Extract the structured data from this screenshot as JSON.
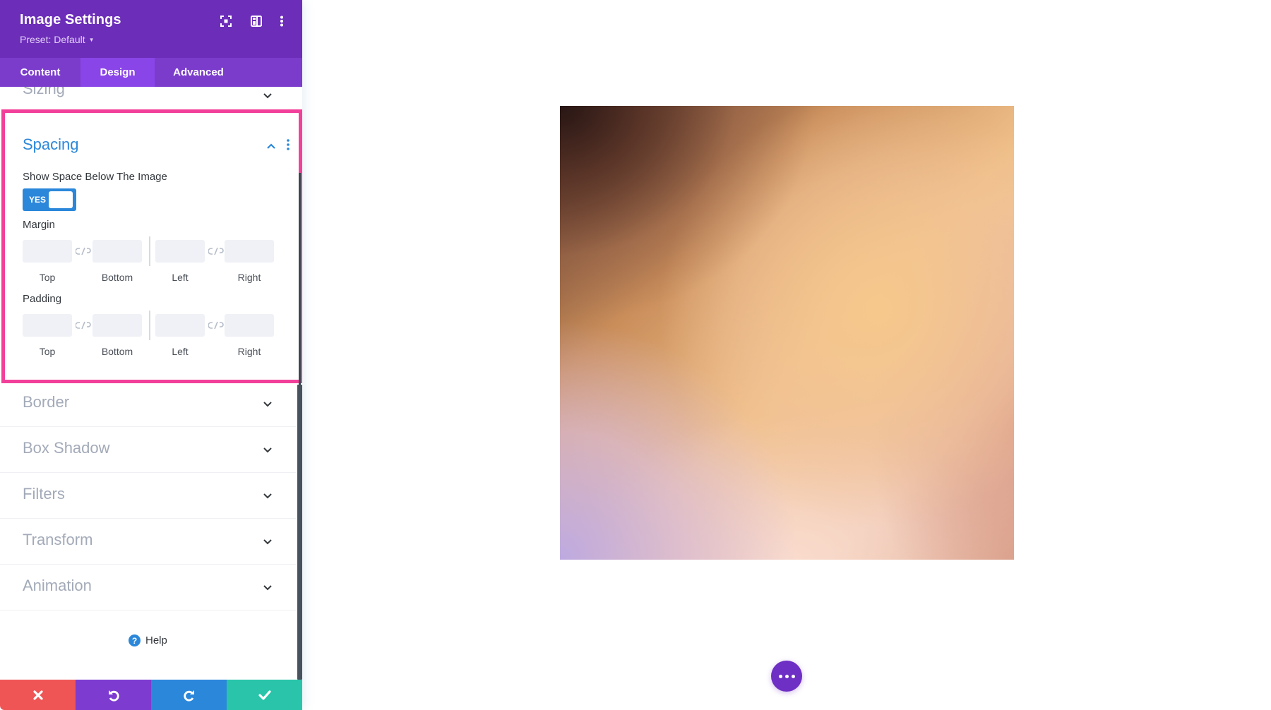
{
  "panel": {
    "title": "Image Settings",
    "preset_label": "Preset: Default",
    "header_icons": [
      "fullscreen-icon",
      "split-view-icon",
      "more-vertical-icon"
    ],
    "tabs": [
      {
        "label": "Content",
        "active": false
      },
      {
        "label": "Design",
        "active": true
      },
      {
        "label": "Advanced",
        "active": false
      }
    ]
  },
  "sections": {
    "sizing": {
      "label": "Sizing",
      "expanded": false
    },
    "spacing": {
      "label": "Spacing",
      "expanded": true,
      "show_space_label": "Show Space Below The Image",
      "toggle": {
        "label": "YES",
        "on": true
      },
      "margin": {
        "label": "Margin",
        "fields": [
          {
            "label": "Top",
            "value": ""
          },
          {
            "label": "Bottom",
            "value": ""
          },
          {
            "label": "Left",
            "value": ""
          },
          {
            "label": "Right",
            "value": ""
          }
        ]
      },
      "padding": {
        "label": "Padding",
        "fields": [
          {
            "label": "Top",
            "value": ""
          },
          {
            "label": "Bottom",
            "value": ""
          },
          {
            "label": "Left",
            "value": ""
          },
          {
            "label": "Right",
            "value": ""
          }
        ]
      }
    },
    "collapsed": [
      {
        "label": "Border"
      },
      {
        "label": "Box Shadow"
      },
      {
        "label": "Filters"
      },
      {
        "label": "Transform"
      },
      {
        "label": "Animation"
      }
    ]
  },
  "help_label": "Help",
  "footer": {
    "buttons": [
      "cancel",
      "undo",
      "redo",
      "save"
    ]
  },
  "colors": {
    "header": "#6c2eb9",
    "tab_bar": "#7b3ccc",
    "tab_active": "#8a45e8",
    "accent_blue": "#2b87da",
    "highlight": "#f2409a",
    "cancel": "#ef5555",
    "undo": "#7d3bcf",
    "redo": "#2b87da",
    "save": "#29c4a9"
  }
}
